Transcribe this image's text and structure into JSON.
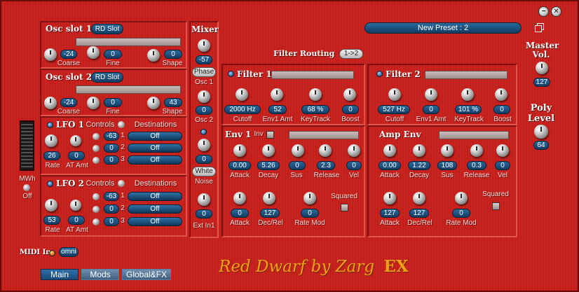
{
  "preset": {
    "name": "New Preset : 2"
  },
  "window": {
    "minimize_glyph": "−",
    "close_glyph": "✕"
  },
  "osc1": {
    "title": "Osc slot 1",
    "slot": "RD Slot",
    "coarse": "-24",
    "fine": "0",
    "shape": "0",
    "coarse_label": "Coarse",
    "fine_label": "Fine",
    "shape_label": "Shape"
  },
  "osc2": {
    "title": "Osc slot 2",
    "slot": "RD Slot",
    "coarse": "-24",
    "fine": "0",
    "shape": "43",
    "coarse_label": "Coarse",
    "fine_label": "Fine",
    "shape_label": "Shape"
  },
  "lfo1": {
    "title": "LFO 1",
    "controls": "Controls",
    "destinations": "Destinations",
    "rate": "26",
    "at_amt": "0",
    "rate_label": "Rate",
    "at_label": "AT Amt",
    "amts": [
      "-63",
      "0",
      "0"
    ],
    "nums": [
      "1",
      "2",
      "3"
    ],
    "dests": [
      "Off",
      "Off",
      "Off"
    ]
  },
  "lfo2": {
    "title": "LFO 2",
    "controls": "Controls",
    "destinations": "Destinations",
    "rate": "53",
    "at_amt": "0",
    "rate_label": "Rate",
    "at_label": "AT Amt",
    "amts": [
      "-63",
      "0",
      "0"
    ],
    "nums": [
      "1",
      "2",
      "3"
    ],
    "dests": [
      "Off",
      "Off",
      "Off"
    ]
  },
  "mixer": {
    "title": "Mixer",
    "osc1_val": "-57",
    "phase": "Phase",
    "osc1_label": "Osc 1",
    "osc2_val": "0",
    "osc2_label": "Osc 2",
    "white_val": "0",
    "white": "White",
    "noise_label": "Noise",
    "ext_val": "0",
    "ext_label": "Ext In1"
  },
  "routing": {
    "label": "Filter Routing",
    "value": "1->2"
  },
  "filter1": {
    "title": "Filter 1",
    "cutoff": "2000 Hz",
    "env1": "52",
    "keytrack": "68 %",
    "boost": "0",
    "cutoff_label": "Cutoff",
    "env1_label": "Env1 Amt",
    "key_label": "KeyTrack",
    "boost_label": "Boost"
  },
  "filter2": {
    "title": "Filter 2",
    "cutoff": "527 Hz",
    "env1": "0",
    "keytrack": "101 %",
    "boost": "0",
    "cutoff_label": "Cutoff",
    "env1_label": "Env1 Amt",
    "key_label": "KeyTrack",
    "boost_label": "Boost"
  },
  "env1": {
    "title": "Env 1",
    "inv": "Inv",
    "attack": "0.00",
    "decay": "5.26",
    "sus": "0",
    "release": "2.3",
    "vel": "0",
    "attack_label": "Attack",
    "decay_label": "Decay",
    "sus_label": "Sus",
    "release_label": "Release",
    "vel_label": "Vel",
    "attack2": "0",
    "decrel": "127",
    "ratemod": "0",
    "decrel_label": "Dec/Rel",
    "ratemod_label": "Rate Mod",
    "squared": "Squared"
  },
  "ampenv": {
    "title": "Amp Env",
    "attack": "0.00",
    "decay": "1.22",
    "sus": "108",
    "release": "0.3",
    "vel": "0",
    "attack_label": "Attack",
    "decay_label": "Decay",
    "sus_label": "Sus",
    "release_label": "Release",
    "vel_label": "Vel",
    "attack2": "127",
    "decrel": "127",
    "ratemod": "0",
    "decrel_label": "Dec/Rel",
    "ratemod_label": "Rate Mod",
    "squared": "Squared"
  },
  "master": {
    "title_line1": "Master",
    "title_line2": "Vol.",
    "value": "127"
  },
  "poly": {
    "title_line1": "Poly",
    "title_line2": "Level",
    "value": "64"
  },
  "wheel": {
    "label": "MWh",
    "off": "Off"
  },
  "midi": {
    "label": "MIDI In",
    "mode": "omni"
  },
  "tabs": [
    {
      "label": "Main"
    },
    {
      "label": "Mods"
    },
    {
      "label": "Global&FX"
    }
  ],
  "logo": {
    "text": "Red Dwarf by Zarg",
    "suffix": "EX"
  }
}
